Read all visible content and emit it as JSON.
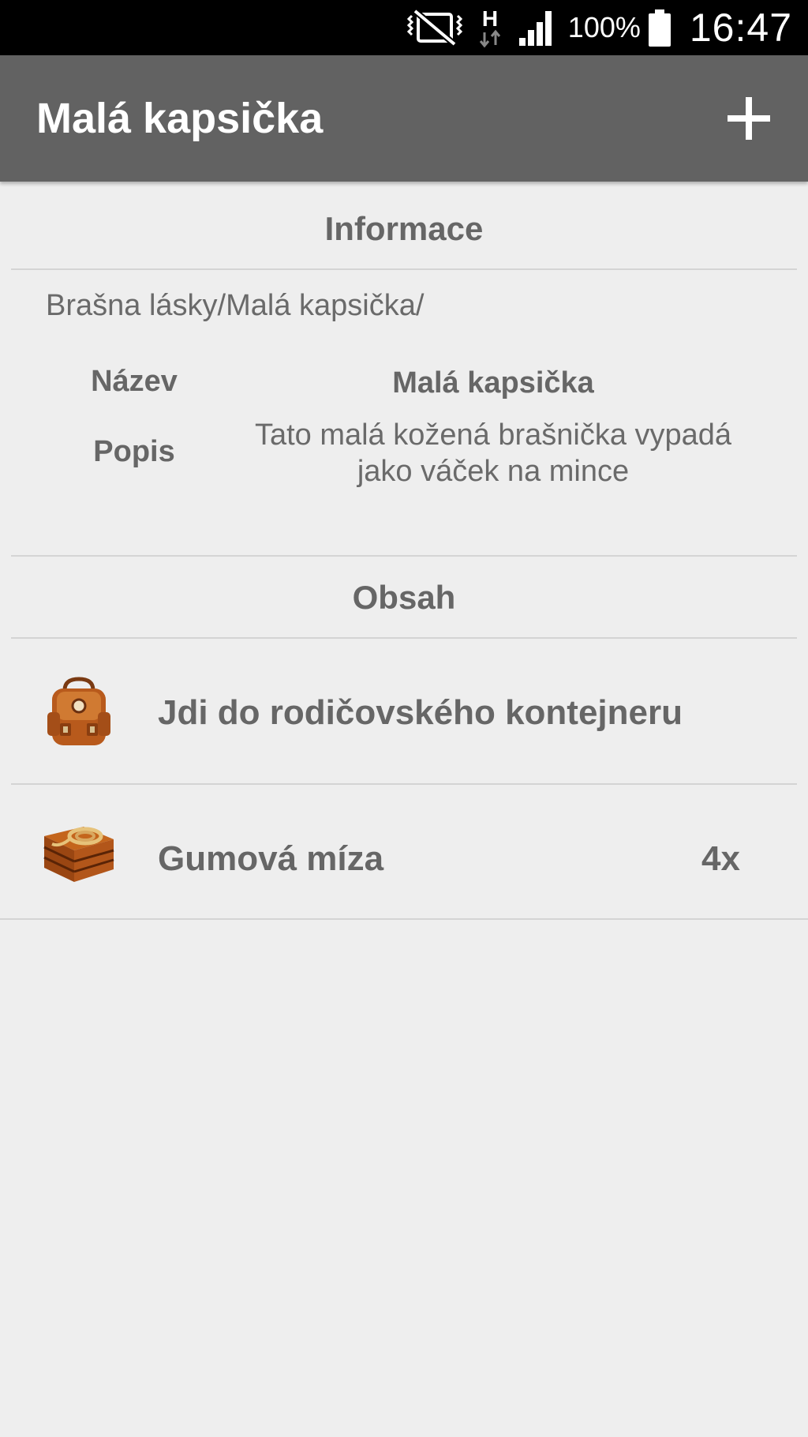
{
  "status_bar": {
    "icons": [
      "vibrate-mute-icon",
      "hspa-data-icon",
      "signal-icon",
      "battery-icon"
    ],
    "network": "H",
    "battery": "100%",
    "time": "16:47"
  },
  "toolbar": {
    "title": "Malá kapsička",
    "add_icon": "plus-icon"
  },
  "info": {
    "header": "Informace",
    "path": "Brašna lásky/Malá kapsička/",
    "name_label": "Název",
    "name_value": "Malá kapsička",
    "desc_label": "Popis",
    "desc_value": "Tato malá kožená brašnička vypadá jako váček na mince"
  },
  "contents": {
    "header": "Obsah",
    "items": [
      {
        "icon": "leather-backpack-icon",
        "label": "Jdi do rodičovského kontejneru",
        "quantity": ""
      },
      {
        "icon": "wooden-crate-icon",
        "label": "Gumová míza",
        "quantity": "4x"
      }
    ]
  },
  "colors": {
    "status_bar": "#000000",
    "toolbar": "#626262",
    "background": "#eeeeee",
    "text": "#666666",
    "divider": "#d4d4d4"
  }
}
